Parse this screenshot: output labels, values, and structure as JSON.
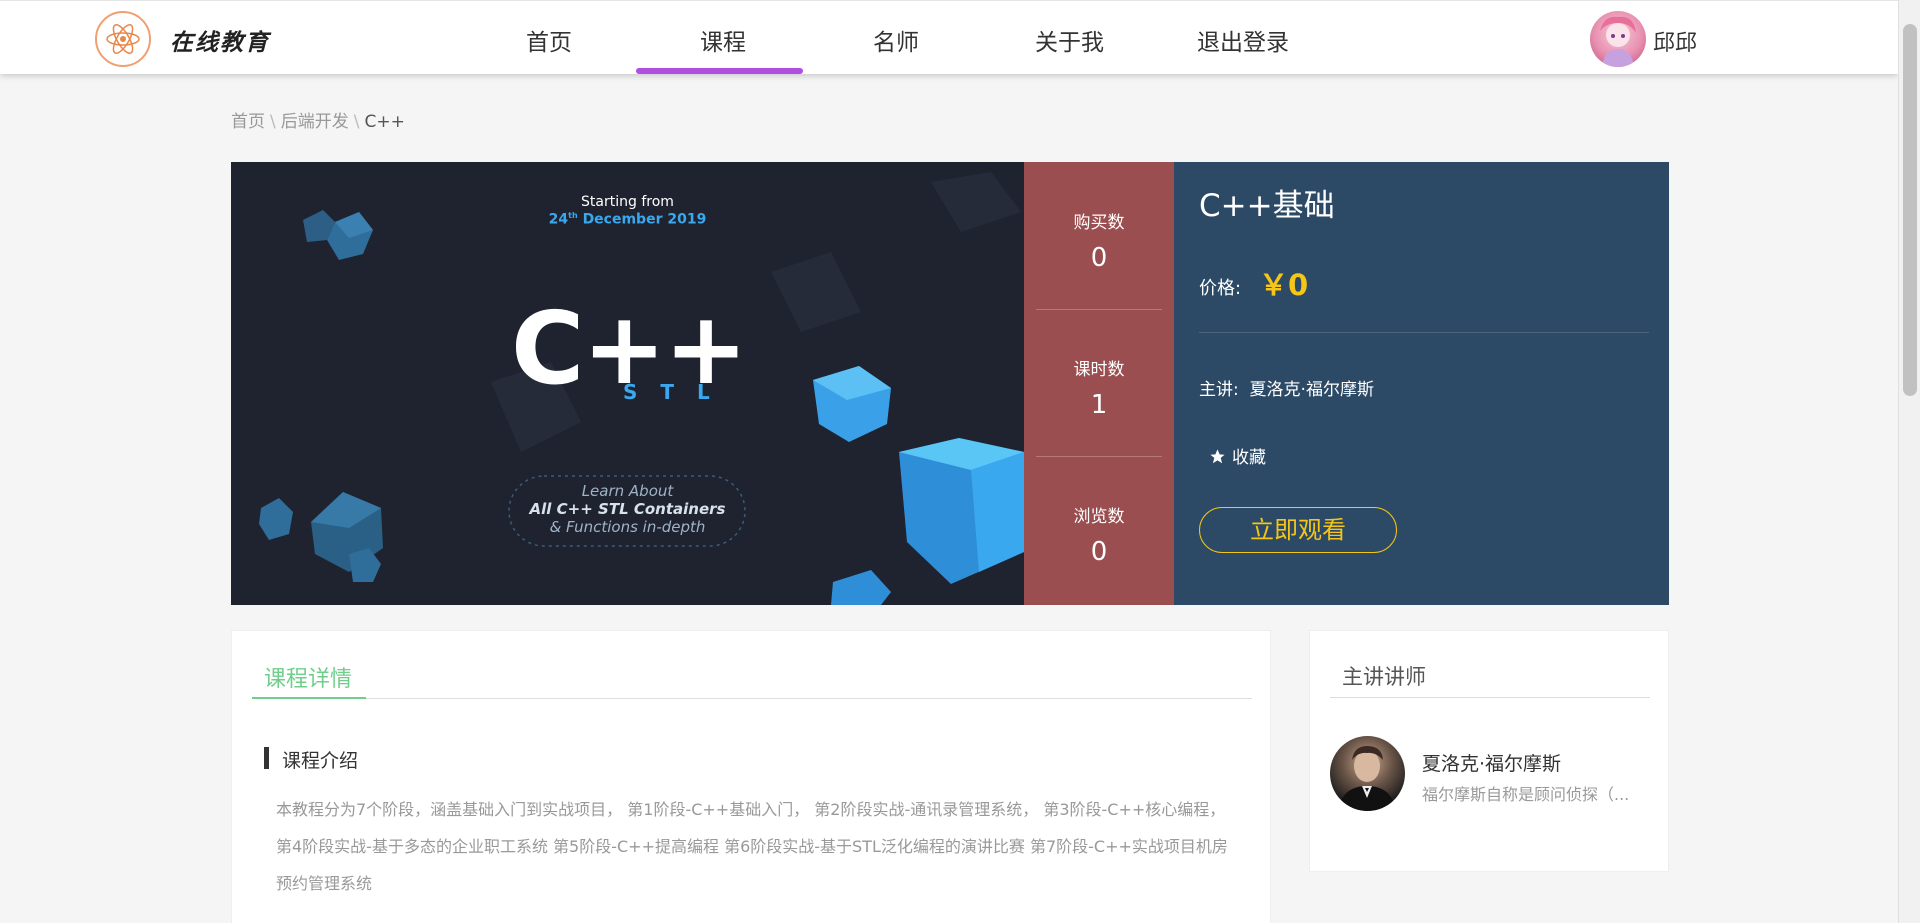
{
  "header": {
    "logo_text": "在线教育",
    "nav": [
      "首页",
      "课程",
      "名师",
      "关于我",
      "退出登录"
    ],
    "active_nav": "课程",
    "username": "邱邱"
  },
  "breadcrumb": [
    "首页",
    "后端开发",
    "C++"
  ],
  "cover": {
    "starting": "Starting from",
    "date_day": "24",
    "date_sup": "th",
    "date_rest": "December 2019",
    "cpp": "C++",
    "stl": "S T L",
    "learn1": "Learn About",
    "learn2": "All C++ STL Containers",
    "learn3": "& Functions in-depth"
  },
  "stats": {
    "buy_label": "购买数",
    "buy_value": "0",
    "lesson_label": "课时数",
    "lesson_value": "1",
    "view_label": "浏览数",
    "view_value": "0"
  },
  "course": {
    "title": "C++基础",
    "price_label": "价格:",
    "price_value": "￥0",
    "teacher_label": "主讲:",
    "teacher_name": "夏洛克·福尔摩斯",
    "favorite_label": "收藏",
    "watch_label": "立即观看"
  },
  "detail": {
    "tab": "课程详情",
    "section_title": "课程介绍",
    "intro": "本教程分为7个阶段，涵盖基础入门到实战项目， 第1阶段-C++基础入门， 第2阶段实战-通讯录管理系统， 第3阶段-C++核心编程， 第4阶段实战-基于多态的企业职工系统 第5阶段-C++提高编程 第6阶段实战-基于STL泛化编程的演讲比赛 第7阶段-C++实战项目机房预约管理系统"
  },
  "lecturer": {
    "title": "主讲讲师",
    "name": "夏洛克·福尔摩斯",
    "desc": "福尔摩斯自称是顾问侦探（..."
  },
  "colors": {
    "nav_underline": "#b04ee0",
    "stats_bg": "#9a4e4f",
    "info_bg": "#2c4a66",
    "price": "#f5c518",
    "tab_green": "#6fcf8a"
  }
}
